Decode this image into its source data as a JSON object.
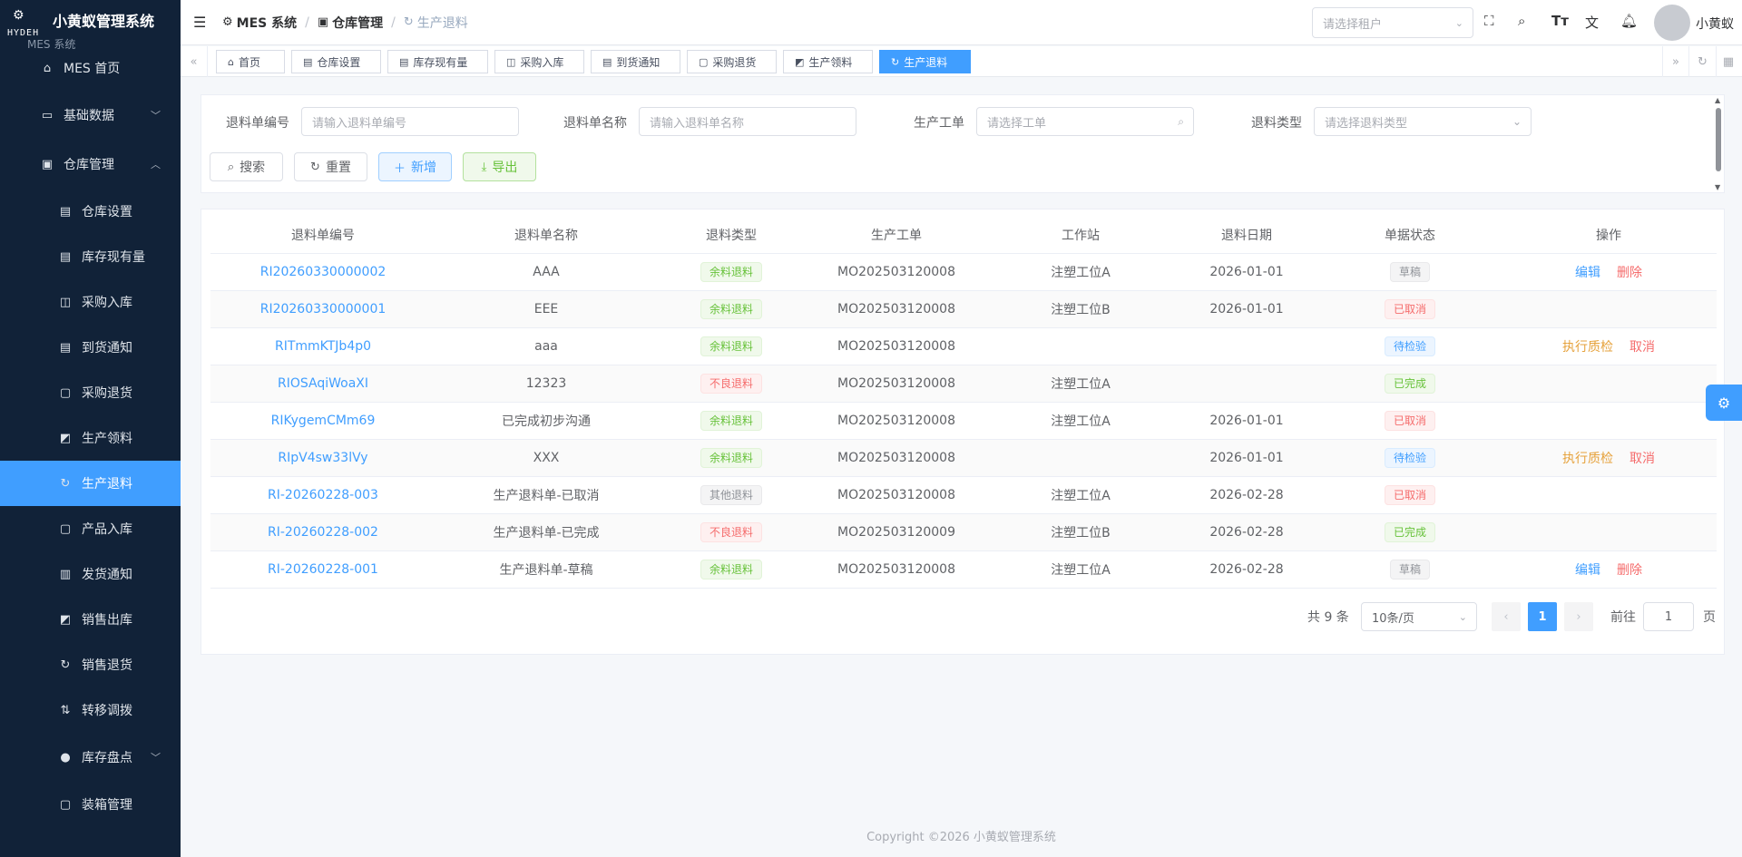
{
  "app": {
    "title": "小黄蚁管理系统",
    "logo_text": "HYDEH",
    "logo_sub": "MES 系统",
    "footer": "Copyright ©2026 小黄蚁管理系统"
  },
  "sidebar": {
    "items": [
      {
        "label": "MES 首页",
        "icon": "home-icon",
        "level": "top"
      },
      {
        "label": "基础数据",
        "icon": "monitor-icon",
        "level": "top",
        "arrow": "down"
      },
      {
        "label": "仓库管理",
        "icon": "warehouse-icon",
        "level": "top",
        "arrow": "up"
      },
      {
        "label": "仓库设置",
        "icon": "document-icon",
        "level": "sub"
      },
      {
        "label": "库存现有量",
        "icon": "document-icon",
        "level": "sub"
      },
      {
        "label": "采购入库",
        "icon": "bag-icon",
        "level": "sub"
      },
      {
        "label": "到货通知",
        "icon": "document-check-icon",
        "level": "sub"
      },
      {
        "label": "采购退货",
        "icon": "box-icon",
        "level": "sub"
      },
      {
        "label": "生产领料",
        "icon": "basket-icon",
        "level": "sub"
      },
      {
        "label": "生产退料",
        "icon": "refresh-icon",
        "level": "sub",
        "active": true
      },
      {
        "label": "产品入库",
        "icon": "box-icon",
        "level": "sub"
      },
      {
        "label": "发货通知",
        "icon": "clipboard-icon",
        "level": "sub"
      },
      {
        "label": "销售出库",
        "icon": "basket-icon",
        "level": "sub"
      },
      {
        "label": "销售退货",
        "icon": "refresh-icon",
        "level": "sub"
      },
      {
        "label": "转移调拨",
        "icon": "sort-icon",
        "level": "sub"
      },
      {
        "label": "库存盘点",
        "icon": "check-circle-icon",
        "level": "top-indent",
        "arrow": "down"
      },
      {
        "label": "装箱管理",
        "icon": "box-icon",
        "level": "sub"
      }
    ]
  },
  "header": {
    "breadcrumb": [
      {
        "label": "MES 系统",
        "icon": "chip-icon"
      },
      {
        "label": "仓库管理",
        "icon": "warehouse-icon"
      },
      {
        "label": "生产退料",
        "icon": "refresh-icon"
      }
    ],
    "tenant_placeholder": "请选择租户",
    "username": "小黄蚁"
  },
  "tags": [
    {
      "label": "首页",
      "icon": "home-icon"
    },
    {
      "label": "仓库设置",
      "icon": "document-icon"
    },
    {
      "label": "库存现有量",
      "icon": "document-icon"
    },
    {
      "label": "采购入库",
      "icon": "bag-icon"
    },
    {
      "label": "到货通知",
      "icon": "document-check-icon"
    },
    {
      "label": "采购退货",
      "icon": "box-icon"
    },
    {
      "label": "生产领料",
      "icon": "basket-icon"
    },
    {
      "label": "生产退料",
      "icon": "refresh-icon",
      "active": true
    }
  ],
  "search": {
    "fields": [
      {
        "label": "退料单编号",
        "placeholder": "请输入退料单编号"
      },
      {
        "label": "退料单名称",
        "placeholder": "请输入退料单名称"
      },
      {
        "label": "生产工单",
        "placeholder": "请选择工单"
      },
      {
        "label": "退料类型",
        "placeholder": "请选择退料类型"
      }
    ],
    "buttons": {
      "search": "搜索",
      "reset": "重置",
      "add": "新增",
      "export": "导出"
    }
  },
  "table": {
    "columns": [
      "退料单编号",
      "退料单名称",
      "退料类型",
      "生产工单",
      "工作站",
      "退料日期",
      "单据状态",
      "操作"
    ],
    "rows": [
      {
        "code": "RI20260330000002",
        "name": "AAA",
        "type": "余料退料",
        "type_style": "success",
        "order": "MO202503120008",
        "station": "注塑工位A",
        "date": "2026-01-01",
        "status": "草稿",
        "status_style": "info",
        "ops": [
          {
            "label": "编辑",
            "style": "blue"
          },
          {
            "label": "删除",
            "style": "red"
          }
        ]
      },
      {
        "code": "RI20260330000001",
        "name": "EEE",
        "type": "余料退料",
        "type_style": "success",
        "order": "MO202503120008",
        "station": "注塑工位B",
        "date": "2026-01-01",
        "status": "已取消",
        "status_style": "danger",
        "ops": []
      },
      {
        "code": "RITmmKTJb4p0",
        "name": "aaa",
        "type": "余料退料",
        "type_style": "success",
        "order": "MO202503120008",
        "station": "",
        "date": "",
        "status": "待检验",
        "status_style": "primary",
        "ops": [
          {
            "label": "执行质检",
            "style": "orange"
          },
          {
            "label": "取消",
            "style": "red"
          }
        ]
      },
      {
        "code": "RIOSAqiWoaXI",
        "name": "12323",
        "type": "不良退料",
        "type_style": "danger",
        "order": "MO202503120008",
        "station": "注塑工位A",
        "date": "",
        "status": "已完成",
        "status_style": "success",
        "ops": []
      },
      {
        "code": "RIKygemCMm69",
        "name": "已完成初步沟通",
        "type": "余料退料",
        "type_style": "success",
        "order": "MO202503120008",
        "station": "注塑工位A",
        "date": "2026-01-01",
        "status": "已取消",
        "status_style": "danger",
        "ops": []
      },
      {
        "code": "RIpV4sw33lVy",
        "name": "XXX",
        "type": "余料退料",
        "type_style": "success",
        "order": "MO202503120008",
        "station": "",
        "date": "2026-01-01",
        "status": "待检验",
        "status_style": "primary",
        "ops": [
          {
            "label": "执行质检",
            "style": "orange"
          },
          {
            "label": "取消",
            "style": "red"
          }
        ]
      },
      {
        "code": "RI-20260228-003",
        "name": "生产退料单-已取消",
        "type": "其他退料",
        "type_style": "info",
        "order": "MO202503120008",
        "station": "注塑工位A",
        "date": "2026-02-28",
        "status": "已取消",
        "status_style": "danger",
        "ops": []
      },
      {
        "code": "RI-20260228-002",
        "name": "生产退料单-已完成",
        "type": "不良退料",
        "type_style": "danger",
        "order": "MO202503120009",
        "station": "注塑工位B",
        "date": "2026-02-28",
        "status": "已完成",
        "status_style": "success",
        "ops": []
      },
      {
        "code": "RI-20260228-001",
        "name": "生产退料单-草稿",
        "type": "余料退料",
        "type_style": "success",
        "order": "MO202503120008",
        "station": "注塑工位A",
        "date": "2026-02-28",
        "status": "草稿",
        "status_style": "info",
        "ops": [
          {
            "label": "编辑",
            "style": "blue"
          },
          {
            "label": "删除",
            "style": "red"
          }
        ]
      }
    ]
  },
  "pagination": {
    "total": "共 9 条",
    "page_size": "10条/页",
    "current_page": "1",
    "goto_label": "前往",
    "goto_value": "1",
    "page_suffix": "页"
  },
  "colors": {
    "primary": "#409eff",
    "sidebar_bg": "#112238",
    "success": "#67c23a",
    "danger": "#f56c6c",
    "warning": "#e6a23c"
  }
}
